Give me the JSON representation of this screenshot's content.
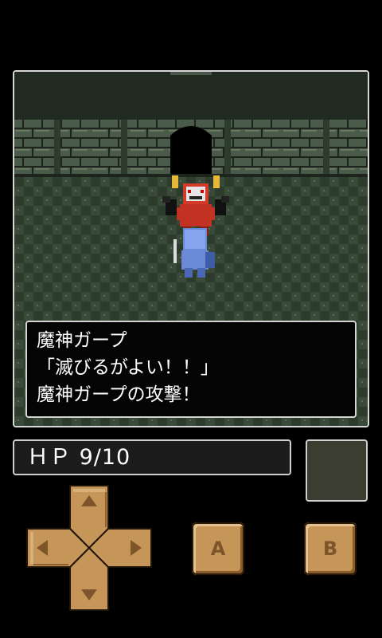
{
  "dialog": {
    "lines": [
      "魔神ガープ",
      "「滅びるがよい！！」",
      "魔神ガープの攻撃！"
    ]
  },
  "status": {
    "hp_label": "ＨＰ 9/10"
  },
  "controls": {
    "a_label": "A",
    "b_label": "B",
    "dpad_icons": [
      "arrow-up-icon",
      "arrow-down-icon",
      "arrow-left-icon",
      "arrow-right-icon"
    ]
  },
  "colors": {
    "floor_dark": "#2c3a2c",
    "floor_light": "#3b4d3a",
    "wall": "#4a5a48",
    "button_tan": "#c69659",
    "dialog_border": "#d4d4d4"
  }
}
